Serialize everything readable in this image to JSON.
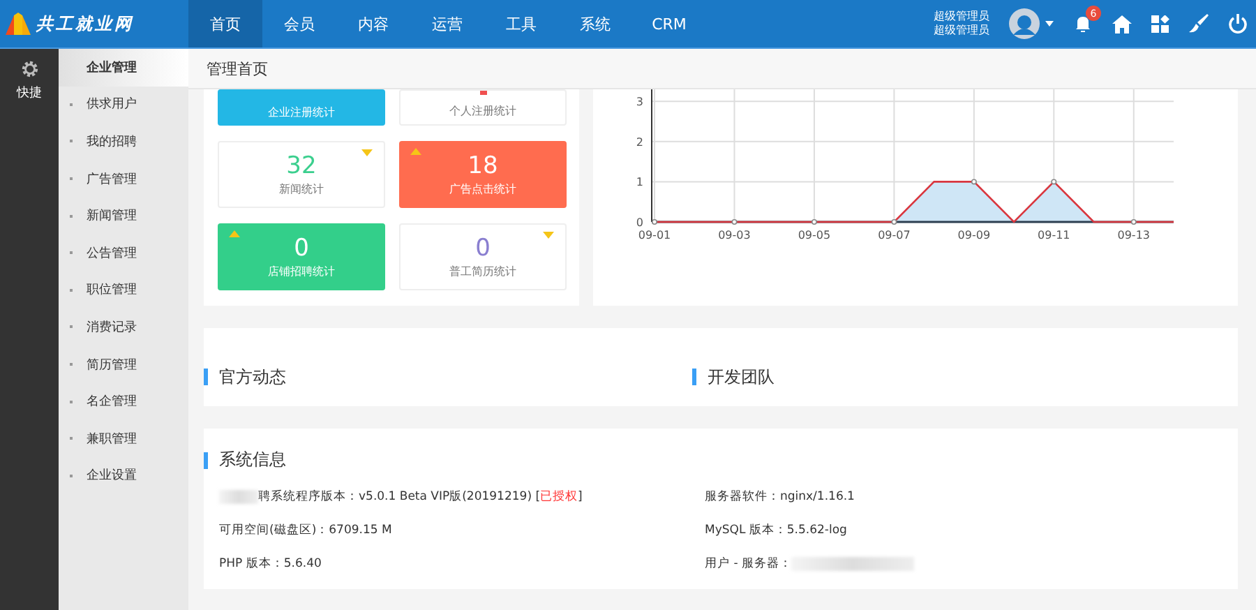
{
  "logo": {
    "text": "共工就业网"
  },
  "nav": [
    {
      "label": "首页",
      "selected": true
    },
    {
      "label": "会员",
      "selected": false
    },
    {
      "label": "内容",
      "selected": false
    },
    {
      "label": "运营",
      "selected": false
    },
    {
      "label": "工具",
      "selected": false
    },
    {
      "label": "系统",
      "selected": false
    },
    {
      "label": "CRM",
      "selected": false
    }
  ],
  "user": {
    "name": "超级管理员",
    "role": "超级管理员"
  },
  "notifications": {
    "count": "6"
  },
  "rail": {
    "label": "快捷"
  },
  "submenu": [
    {
      "label": "企业管理",
      "selected": true
    },
    {
      "label": "供求用户",
      "selected": false
    },
    {
      "label": "我的招聘",
      "selected": false
    },
    {
      "label": "广告管理",
      "selected": false
    },
    {
      "label": "新闻管理",
      "selected": false
    },
    {
      "label": "公告管理",
      "selected": false
    },
    {
      "label": "职位管理",
      "selected": false
    },
    {
      "label": "消费记录",
      "selected": false
    },
    {
      "label": "简历管理",
      "selected": false
    },
    {
      "label": "名企管理",
      "selected": false
    },
    {
      "label": "兼职管理",
      "selected": false
    },
    {
      "label": "企业设置",
      "selected": false
    }
  ],
  "breadcrumb": "管理首页",
  "stats": [
    {
      "kind": "filled",
      "color": "#23b7e5",
      "label": "企业注册统计",
      "cut": true
    },
    {
      "kind": "outline",
      "color": "#f05050",
      "label": "个人注册统计",
      "cut": true
    },
    {
      "kind": "outline",
      "color": "#3bcf8e",
      "value": "32",
      "label": "新闻统计",
      "trend_up": false
    },
    {
      "kind": "filled",
      "color": "#ff6c4f",
      "value": "18",
      "label": "广告点击统计",
      "trend_up": true
    },
    {
      "kind": "filled",
      "color": "#33cf8a",
      "value": "0",
      "label": "店铺招聘统计",
      "trend_up": true
    },
    {
      "kind": "outline",
      "color": "#8a7fd0",
      "value": "0",
      "label": "普工简历统计",
      "trend_up": false
    }
  ],
  "chart": {
    "chart_data": {
      "type": "area",
      "categories": [
        "09-01",
        null,
        "09-03",
        null,
        "09-05",
        null,
        "09-07",
        null,
        "09-09",
        null,
        "09-11",
        null,
        "09-13",
        null
      ],
      "series": [
        {
          "color": "#d9363e",
          "values": [
            0,
            0,
            0,
            0,
            0,
            0,
            0,
            1,
            1,
            0,
            1,
            0,
            0,
            0
          ]
        }
      ],
      "yticks": [
        0,
        1,
        2,
        3
      ],
      "ylim": [
        0,
        3.3
      ],
      "grid": true
    }
  },
  "panels": [
    {
      "title": "官方动态"
    },
    {
      "title": "开发团队"
    }
  ],
  "sysinfo": {
    "title": "系统信息",
    "rows": [
      {
        "label": "聘系统程序版本：",
        "value": "v5.0.1 Beta VIP版(20191219) [",
        "status": "已授权",
        "tail": "]",
        "blur_before": true
      },
      {
        "label": "服务器软件：",
        "value": "nginx/1.16.1"
      },
      {
        "label": "可用空间(磁盘区)：",
        "value": "6709.15 M"
      },
      {
        "label": "MySQL 版本：",
        "value": "5.5.62-log"
      },
      {
        "label": "PHP 版本：",
        "value": "5.6.40"
      },
      {
        "label": "用户 - 服务器：",
        "blur_after": true
      }
    ]
  }
}
